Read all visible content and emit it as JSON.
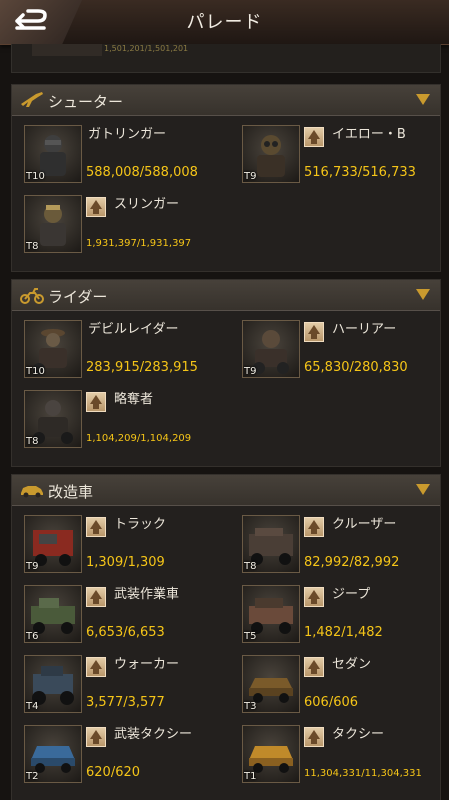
{
  "header": {
    "title": "パレード",
    "back_icon": "back-arrow-icon"
  },
  "previous_section_tail": {
    "text": "1,501,201/1,501,201"
  },
  "sections": [
    {
      "title": "シューター",
      "icon": "rifle-icon",
      "units": [
        {
          "name": "ガトリンガー",
          "tier": "T10",
          "count": "588,008/588,008",
          "upgrade": false
        },
        {
          "name": "イエロー・B",
          "tier": "T9",
          "count": "516,733/516,733",
          "upgrade": true
        },
        {
          "name": "スリンガー",
          "tier": "T8",
          "count": "1,931,397/1,931,397",
          "upgrade": true
        }
      ]
    },
    {
      "title": "ライダー",
      "icon": "motorcycle-icon",
      "units": [
        {
          "name": "デビルレイダー",
          "tier": "T10",
          "count": "283,915/283,915",
          "upgrade": false
        },
        {
          "name": "ハーリアー",
          "tier": "T9",
          "count": "65,830/280,830",
          "upgrade": true
        },
        {
          "name": "略奪者",
          "tier": "T8",
          "count": "1,104,209/1,104,209",
          "upgrade": true
        }
      ]
    },
    {
      "title": "改造車",
      "icon": "car-icon",
      "units": [
        {
          "name": "トラック",
          "tier": "T9",
          "count": "1,309/1,309",
          "upgrade": true
        },
        {
          "name": "クルーザー",
          "tier": "T8",
          "count": "82,992/82,992",
          "upgrade": true
        },
        {
          "name": "武装作業車",
          "tier": "T6",
          "count": "6,653/6,653",
          "upgrade": true
        },
        {
          "name": "ジープ",
          "tier": "T5",
          "count": "1,482/1,482",
          "upgrade": true
        },
        {
          "name": "ウォーカー",
          "tier": "T4",
          "count": "3,577/3,577",
          "upgrade": true
        },
        {
          "name": "セダン",
          "tier": "T3",
          "count": "606/606",
          "upgrade": true
        },
        {
          "name": "武装タクシー",
          "tier": "T2",
          "count": "620/620",
          "upgrade": true
        },
        {
          "name": "タクシー",
          "tier": "T1",
          "count": "11,304,331/11,304,331",
          "upgrade": true
        }
      ]
    }
  ],
  "colors": {
    "accent": "#c99a2e",
    "count": "#f5c518",
    "panel": "#23201e"
  }
}
